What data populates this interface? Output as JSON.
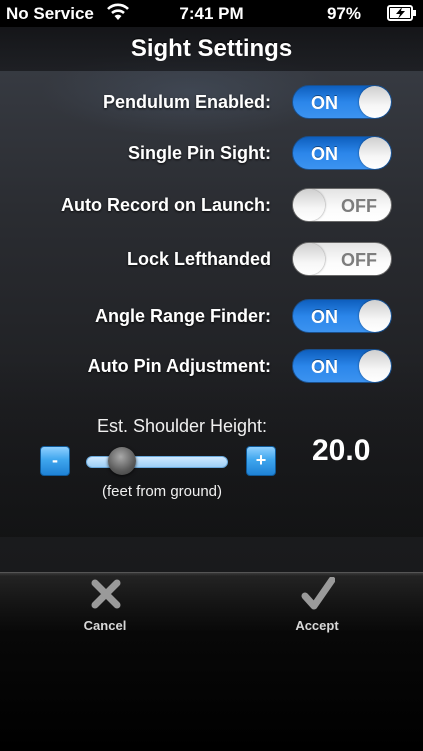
{
  "status": {
    "carrier": "No Service",
    "time": "7:41 PM",
    "battery": "97%"
  },
  "title": "Sight Settings",
  "settings": [
    {
      "label": "Pendulum Enabled:",
      "state": "ON"
    },
    {
      "label": "Single Pin Sight:",
      "state": "ON"
    },
    {
      "label": "Auto Record on Launch:",
      "state": "OFF"
    },
    {
      "label": "Lock Lefthanded",
      "state": "OFF"
    },
    {
      "label": "Angle Range Finder:",
      "state": "ON"
    },
    {
      "label": "Auto Pin Adjustment:",
      "state": "ON"
    }
  ],
  "shoulder": {
    "label": "Est. Shoulder Height:",
    "minus": "-",
    "plus": "+",
    "value": "20.0",
    "unit_note": "(feet from ground)"
  },
  "toolbar": {
    "cancel": "Cancel",
    "accept": "Accept"
  },
  "icons": {
    "wifi": "wifi-icon",
    "battery": "battery-charging-icon",
    "cancel": "x-icon",
    "accept": "checkmark-icon"
  },
  "colors": {
    "toggle_on": "#2b86ea",
    "toggle_off": "#f5f5f5",
    "stepper": "#3fa6ee"
  }
}
